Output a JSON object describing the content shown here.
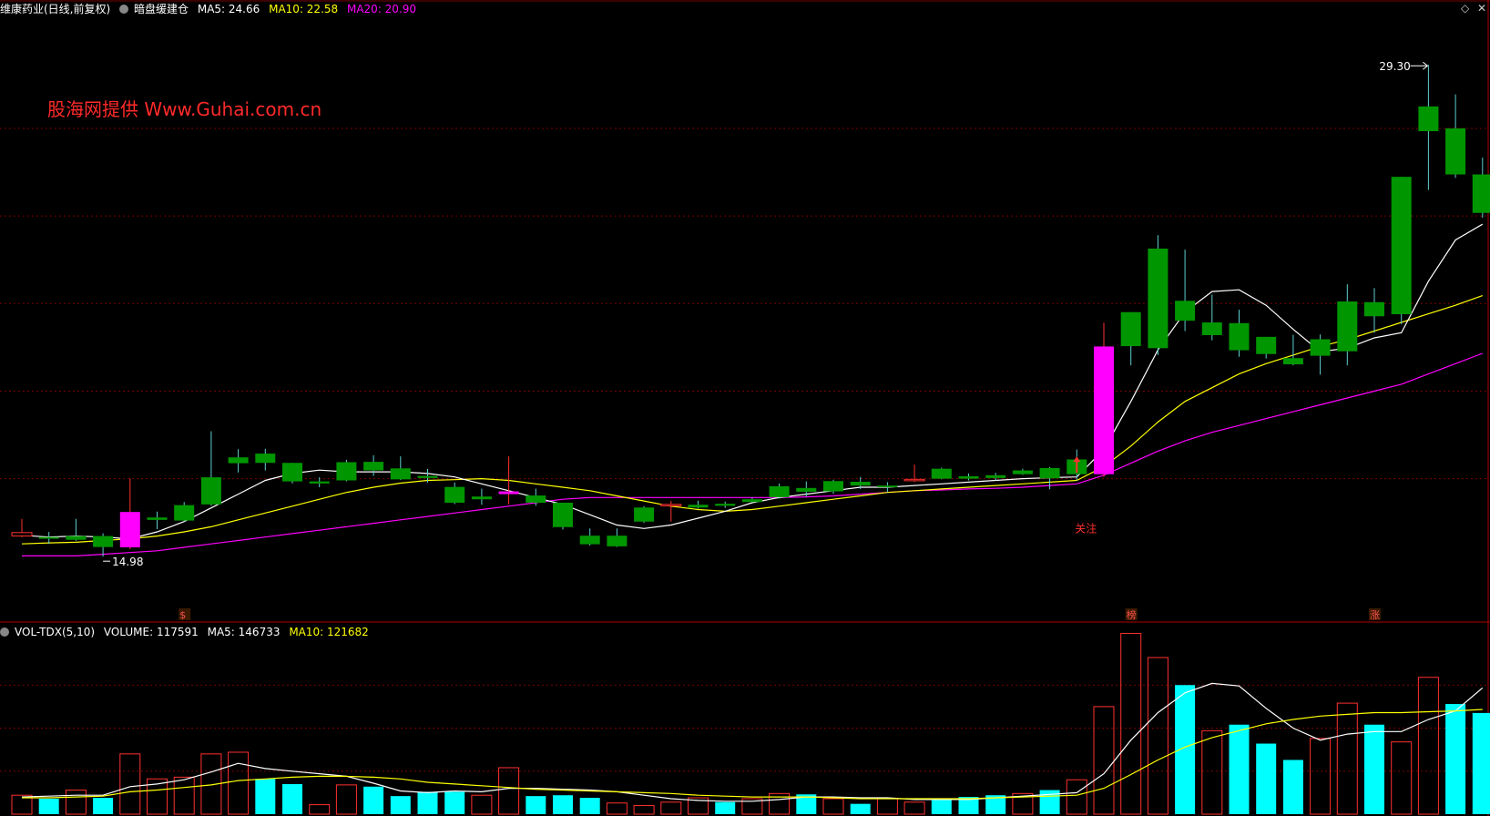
{
  "header": {
    "stock_name": "维康药业(日线,前复权)",
    "indicator_name": "暗盘缓建仓",
    "ma5_label": "MA5: 24.66",
    "ma10_label": "MA10: 22.58",
    "ma20_label": "MA20: 20.90"
  },
  "watermark": "股海网提供  Www.Guhai.com.cn",
  "annotations": {
    "high_label": "29.30",
    "low_label": "14.98",
    "focus_label": "关注",
    "badge_dollar": "$",
    "badge_bang": "榜",
    "badge_zhang": "涨"
  },
  "volume_header": {
    "indicator": "VOL-TDX(5,10)",
    "volume_label": "VOLUME: 117591",
    "ma5_label": "MA5: 146733",
    "ma10_label": "MA10: 121682"
  },
  "colors": {
    "up": "#ff3030",
    "down_candle": "#009600",
    "down_volume": "#00ffff",
    "signal": "#ff00ff",
    "ma5": "#ffffff",
    "ma10": "#ffff00",
    "ma20": "#ff00ff",
    "grid": "#7a0000"
  },
  "chart_data": [
    {
      "type": "candlestick",
      "title": "维康药业(日线,前复权)",
      "ylim": [
        13.5,
        30.5
      ],
      "candles": [
        {
          "o": 15.68,
          "h": 16.08,
          "l": 15.55,
          "c": 15.58,
          "k": "up"
        },
        {
          "o": 15.55,
          "h": 15.7,
          "l": 15.35,
          "c": 15.5,
          "k": "down"
        },
        {
          "o": 15.58,
          "h": 16.08,
          "l": 15.44,
          "c": 15.47,
          "k": "down"
        },
        {
          "o": 15.58,
          "h": 15.66,
          "l": 14.98,
          "c": 15.26,
          "k": "down"
        },
        {
          "o": 15.25,
          "h": 17.26,
          "l": 15.2,
          "c": 16.28,
          "k": "sig"
        },
        {
          "o": 16.05,
          "h": 16.29,
          "l": 15.78,
          "c": 16.12,
          "k": "down"
        },
        {
          "o": 16.48,
          "h": 16.57,
          "l": 16.0,
          "c": 16.03,
          "k": "down"
        },
        {
          "o": 17.29,
          "h": 18.63,
          "l": 16.46,
          "c": 16.5,
          "k": "down"
        },
        {
          "o": 17.87,
          "h": 18.11,
          "l": 17.43,
          "c": 17.7,
          "k": "down"
        },
        {
          "o": 17.98,
          "h": 18.12,
          "l": 17.49,
          "c": 17.71,
          "k": "down"
        },
        {
          "o": 17.71,
          "h": 17.71,
          "l": 17.11,
          "c": 17.17,
          "k": "down"
        },
        {
          "o": 17.17,
          "h": 17.29,
          "l": 17.0,
          "c": 17.11,
          "k": "down"
        },
        {
          "o": 17.73,
          "h": 17.8,
          "l": 17.17,
          "c": 17.2,
          "k": "down"
        },
        {
          "o": 17.74,
          "h": 17.93,
          "l": 17.33,
          "c": 17.49,
          "k": "down"
        },
        {
          "o": 17.55,
          "h": 17.9,
          "l": 17.21,
          "c": 17.23,
          "k": "down"
        },
        {
          "o": 17.33,
          "h": 17.53,
          "l": 17.14,
          "c": 17.27,
          "k": "down"
        },
        {
          "o": 17.01,
          "h": 17.14,
          "l": 16.51,
          "c": 16.55,
          "k": "down"
        },
        {
          "o": 16.73,
          "h": 16.96,
          "l": 16.49,
          "c": 16.65,
          "k": "down"
        },
        {
          "o": 16.88,
          "h": 17.9,
          "l": 16.5,
          "c": 16.8,
          "k": "sig"
        },
        {
          "o": 16.76,
          "h": 16.96,
          "l": 16.46,
          "c": 16.55,
          "k": "down"
        },
        {
          "o": 16.55,
          "h": 16.55,
          "l": 15.77,
          "c": 15.84,
          "k": "down"
        },
        {
          "o": 15.59,
          "h": 15.8,
          "l": 15.3,
          "c": 15.34,
          "k": "down"
        },
        {
          "o": 15.59,
          "h": 15.8,
          "l": 15.26,
          "c": 15.28,
          "k": "down"
        },
        {
          "o": 16.41,
          "h": 16.45,
          "l": 15.96,
          "c": 16.0,
          "k": "down"
        },
        {
          "o": 16.5,
          "h": 16.6,
          "l": 16.0,
          "c": 16.5,
          "k": "up"
        },
        {
          "o": 16.49,
          "h": 16.61,
          "l": 16.38,
          "c": 16.41,
          "k": "down"
        },
        {
          "o": 16.52,
          "h": 16.58,
          "l": 16.4,
          "c": 16.46,
          "k": "down"
        },
        {
          "o": 16.65,
          "h": 16.7,
          "l": 16.55,
          "c": 16.57,
          "k": "down"
        },
        {
          "o": 17.03,
          "h": 17.11,
          "l": 16.67,
          "c": 16.71,
          "k": "down"
        },
        {
          "o": 16.98,
          "h": 17.17,
          "l": 16.73,
          "c": 16.87,
          "k": "down"
        },
        {
          "o": 17.18,
          "h": 17.22,
          "l": 16.81,
          "c": 16.88,
          "k": "down"
        },
        {
          "o": 17.16,
          "h": 17.3,
          "l": 16.95,
          "c": 17.05,
          "k": "down"
        },
        {
          "o": 17.05,
          "h": 17.15,
          "l": 16.85,
          "c": 17.0,
          "k": "down"
        },
        {
          "o": 17.23,
          "h": 17.66,
          "l": 17.15,
          "c": 17.23,
          "k": "up"
        },
        {
          "o": 17.54,
          "h": 17.57,
          "l": 17.23,
          "c": 17.25,
          "k": "down"
        },
        {
          "o": 17.32,
          "h": 17.4,
          "l": 17.2,
          "c": 17.25,
          "k": "down"
        },
        {
          "o": 17.35,
          "h": 17.42,
          "l": 17.2,
          "c": 17.27,
          "k": "down"
        },
        {
          "o": 17.49,
          "h": 17.54,
          "l": 17.36,
          "c": 17.38,
          "k": "down"
        },
        {
          "o": 17.56,
          "h": 17.59,
          "l": 16.94,
          "c": 17.26,
          "k": "down"
        },
        {
          "o": 17.81,
          "h": 18.1,
          "l": 17.19,
          "c": 17.38,
          "k": "down"
        },
        {
          "o": 17.38,
          "h": 21.79,
          "l": 17.3,
          "c": 21.1,
          "k": "sig"
        },
        {
          "o": 22.1,
          "h": 22.1,
          "l": 20.55,
          "c": 21.11,
          "k": "down"
        },
        {
          "o": 23.95,
          "h": 24.34,
          "l": 20.85,
          "c": 21.05,
          "k": "down"
        },
        {
          "o": 22.43,
          "h": 23.92,
          "l": 21.55,
          "c": 21.85,
          "k": "down"
        },
        {
          "o": 21.8,
          "h": 22.61,
          "l": 21.28,
          "c": 21.43,
          "k": "down"
        },
        {
          "o": 21.78,
          "h": 22.17,
          "l": 20.8,
          "c": 20.99,
          "k": "down"
        },
        {
          "o": 21.38,
          "h": 21.38,
          "l": 20.75,
          "c": 20.88,
          "k": "down"
        },
        {
          "o": 20.76,
          "h": 21.44,
          "l": 20.55,
          "c": 20.58,
          "k": "down"
        },
        {
          "o": 21.31,
          "h": 21.45,
          "l": 20.28,
          "c": 20.83,
          "k": "down"
        },
        {
          "o": 22.41,
          "h": 22.91,
          "l": 20.55,
          "c": 20.96,
          "k": "down"
        },
        {
          "o": 22.39,
          "h": 22.8,
          "l": 21.5,
          "c": 21.98,
          "k": "down"
        },
        {
          "o": 26.04,
          "h": 26.04,
          "l": 21.75,
          "c": 22.04,
          "k": "down"
        },
        {
          "o": 28.09,
          "h": 29.3,
          "l": 25.66,
          "c": 27.37,
          "k": "down"
        },
        {
          "o": 27.45,
          "h": 28.44,
          "l": 26.01,
          "c": 26.11,
          "k": "down"
        },
        {
          "o": 26.11,
          "h": 26.6,
          "l": 24.85,
          "c": 24.99,
          "k": "down"
        }
      ],
      "ma5": [
        15.6,
        15.55,
        15.58,
        15.55,
        15.5,
        15.7,
        16.0,
        16.4,
        16.8,
        17.2,
        17.4,
        17.5,
        17.45,
        17.45,
        17.45,
        17.4,
        17.3,
        17.1,
        16.9,
        16.7,
        16.5,
        16.2,
        15.9,
        15.8,
        15.9,
        16.1,
        16.3,
        16.55,
        16.7,
        16.8,
        16.9,
        17.0,
        17.0,
        17.05,
        17.1,
        17.15,
        17.2,
        17.25,
        17.28,
        17.3,
        18.1,
        19.5,
        21.0,
        22.1,
        22.7,
        22.75,
        22.3,
        21.6,
        20.95,
        21.05,
        21.35,
        21.5,
        23.0,
        24.2,
        24.66
      ],
      "ma10": [
        15.35,
        15.38,
        15.4,
        15.45,
        15.5,
        15.58,
        15.7,
        15.85,
        16.05,
        16.25,
        16.45,
        16.65,
        16.85,
        17.0,
        17.12,
        17.2,
        17.22,
        17.25,
        17.2,
        17.1,
        17.0,
        16.9,
        16.75,
        16.6,
        16.45,
        16.35,
        16.3,
        16.35,
        16.45,
        16.55,
        16.65,
        16.75,
        16.85,
        16.9,
        16.95,
        17.0,
        17.05,
        17.1,
        17.15,
        17.2,
        17.6,
        18.2,
        18.9,
        19.5,
        19.9,
        20.3,
        20.6,
        20.85,
        21.1,
        21.3,
        21.55,
        21.8,
        22.05,
        22.3,
        22.58
      ],
      "ma20": [
        15.0,
        15.0,
        15.0,
        15.05,
        15.1,
        15.15,
        15.25,
        15.35,
        15.45,
        15.55,
        15.65,
        15.75,
        15.85,
        15.95,
        16.05,
        16.15,
        16.25,
        16.35,
        16.45,
        16.55,
        16.65,
        16.7,
        16.7,
        16.7,
        16.7,
        16.7,
        16.7,
        16.7,
        16.7,
        16.72,
        16.75,
        16.8,
        16.85,
        16.9,
        16.92,
        16.95,
        16.97,
        17.0,
        17.05,
        17.1,
        17.35,
        17.7,
        18.05,
        18.35,
        18.6,
        18.8,
        19.0,
        19.2,
        19.4,
        19.6,
        19.8,
        20.0,
        20.3,
        20.6,
        20.9
      ],
      "horizontal_gridlines": [
        17.25,
        19.8,
        22.35,
        24.9,
        27.45
      ]
    },
    {
      "type": "bar",
      "title": "VOL-TDX(5,10)",
      "ylim": [
        0,
        200000
      ],
      "volumes": [
        22000,
        18000,
        28000,
        19000,
        70000,
        41000,
        43000,
        70000,
        72000,
        41000,
        35000,
        11000,
        34000,
        32000,
        21000,
        26000,
        26000,
        22000,
        54000,
        21000,
        22000,
        19000,
        13000,
        10000,
        14000,
        19000,
        14000,
        18000,
        24000,
        23000,
        18000,
        12000,
        18000,
        14000,
        18000,
        20000,
        22000,
        24000,
        28000,
        40000,
        125000,
        210000,
        182000,
        150000,
        97000,
        104000,
        82000,
        63000,
        88000,
        129000,
        104000,
        84000,
        159000,
        128000,
        117591
      ],
      "bar_kind": [
        "up",
        "down",
        "up",
        "down",
        "up",
        "up",
        "up",
        "up",
        "up",
        "down",
        "down",
        "up",
        "up",
        "down",
        "down",
        "down",
        "down",
        "up",
        "up",
        "down",
        "down",
        "down",
        "up",
        "up",
        "up",
        "up",
        "down",
        "up",
        "up",
        "down",
        "up",
        "down",
        "up",
        "up",
        "down",
        "down",
        "down",
        "up",
        "down",
        "up",
        "up",
        "up",
        "up",
        "down",
        "up",
        "down",
        "down",
        "down",
        "up",
        "up",
        "down",
        "up",
        "up",
        "down",
        "down"
      ],
      "ma5": [
        20000,
        21000,
        22000,
        22000,
        32000,
        35000,
        40000,
        49000,
        59000,
        53000,
        50000,
        47000,
        44000,
        36000,
        27000,
        25000,
        27000,
        26000,
        30000,
        30000,
        29000,
        28000,
        26000,
        22000,
        18000,
        16000,
        15000,
        15000,
        17000,
        20000,
        20000,
        19000,
        19000,
        17000,
        17000,
        17000,
        19000,
        21000,
        23000,
        25000,
        47000,
        86000,
        118000,
        141000,
        152000,
        149000,
        123000,
        100000,
        86000,
        93000,
        96000,
        96000,
        110000,
        120000,
        146733
      ],
      "ma10": [
        19000,
        19000,
        20000,
        21000,
        26000,
        28000,
        31000,
        34000,
        39000,
        41000,
        43000,
        44000,
        44000,
        43000,
        41000,
        37000,
        35000,
        33000,
        31000,
        29000,
        28000,
        27000,
        26000,
        25000,
        24000,
        22000,
        21000,
        20000,
        20000,
        20000,
        19000,
        18000,
        18000,
        18000,
        18000,
        18000,
        19000,
        20000,
        21000,
        22000,
        30000,
        46000,
        63000,
        78000,
        89000,
        97000,
        105000,
        110000,
        114000,
        116000,
        118000,
        118000,
        119000,
        120000,
        121682
      ]
    }
  ]
}
